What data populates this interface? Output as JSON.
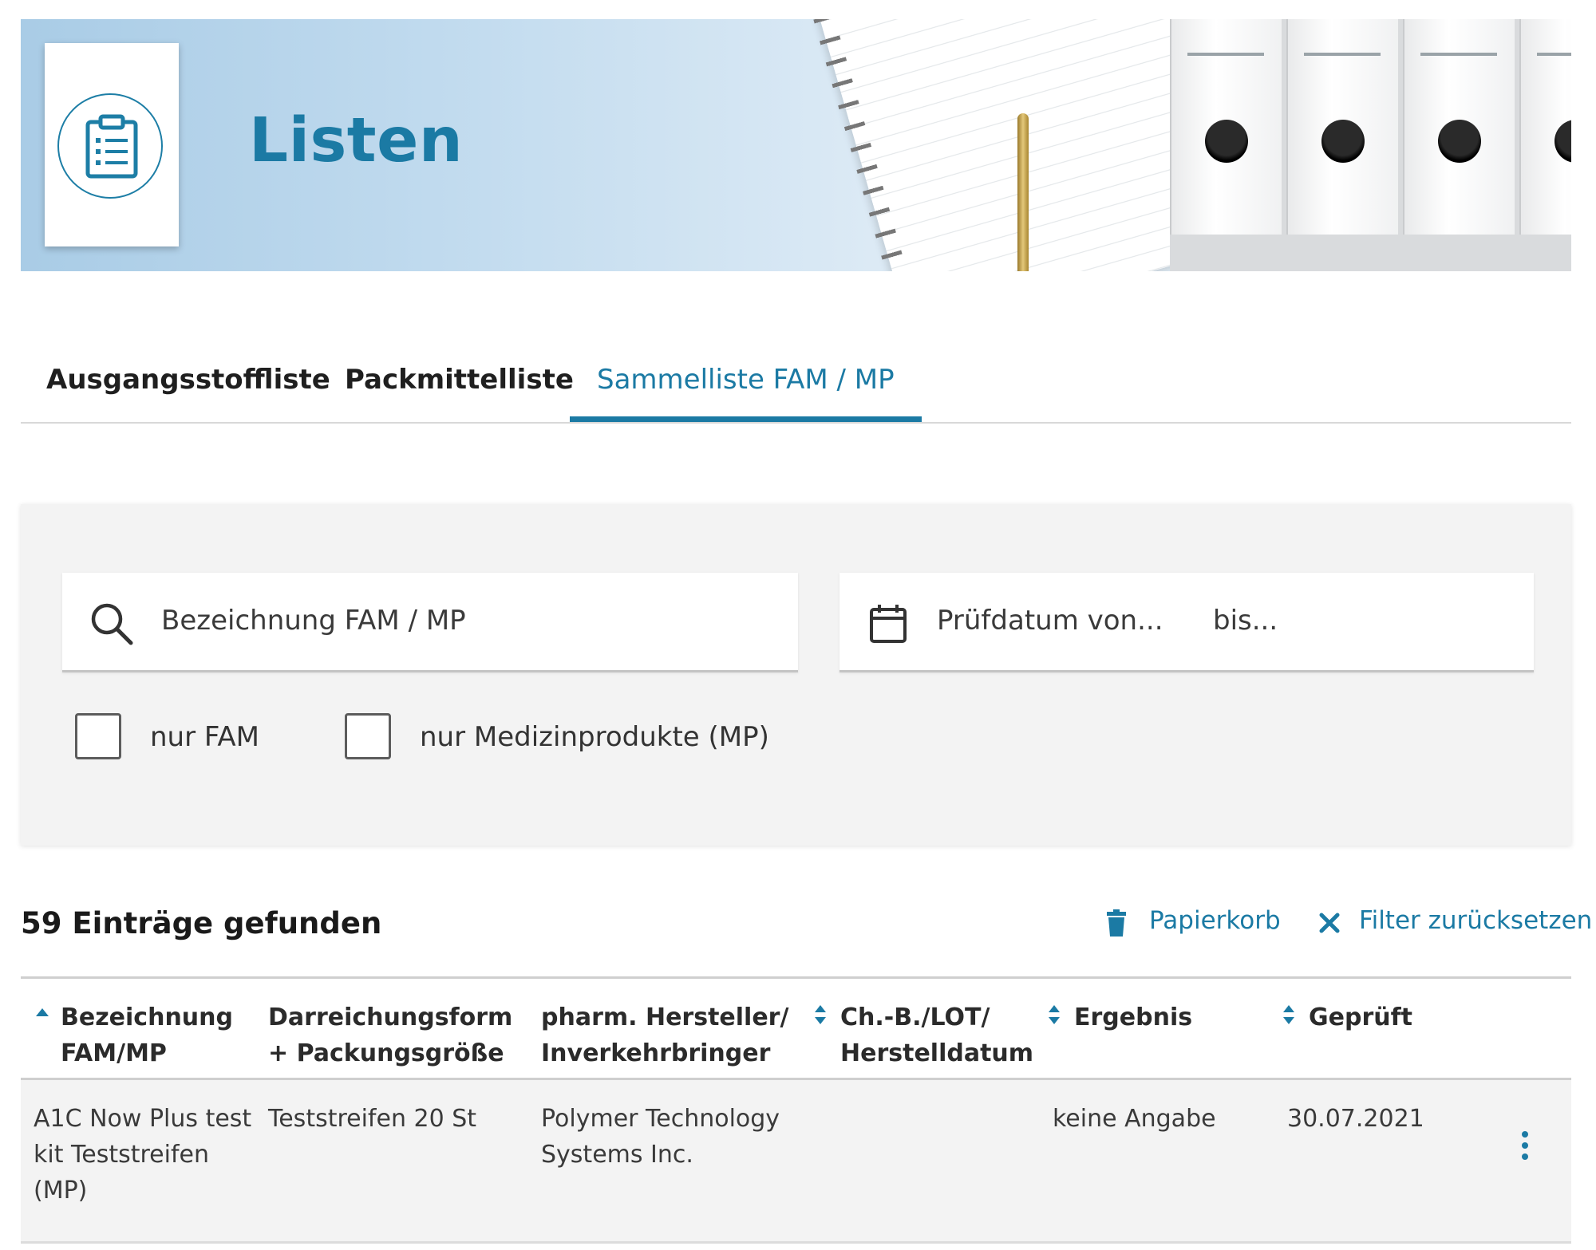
{
  "header": {
    "title": "Listen",
    "logo_icon": "clipboard-list-icon"
  },
  "tabs": [
    {
      "label": "Ausgangsstoffliste",
      "active": false
    },
    {
      "label": "Packmittelliste",
      "active": false
    },
    {
      "label": "Sammelliste FAM / MP",
      "active": true
    }
  ],
  "filters": {
    "search_placeholder": "Bezeichnung FAM / MP",
    "date_from_placeholder": "Prüfdatum von...",
    "date_to_placeholder": "bis...",
    "checkbox_fam": {
      "label": "nur FAM",
      "checked": false
    },
    "checkbox_mp": {
      "label": "nur Medizinprodukte (MP)",
      "checked": false
    }
  },
  "results": {
    "count_text": "59 Einträge gefunden",
    "trash_label": "Papierkorb",
    "reset_label": "Filter zurücksetzen"
  },
  "table": {
    "columns": [
      {
        "line1": "Bezeichnung",
        "line2": "FAM/MP",
        "sort": "asc"
      },
      {
        "line1": "Darreichungsform",
        "line2": "+ Packungsgröße",
        "sort": "none"
      },
      {
        "line1": "pharm. Hersteller/",
        "line2": "Inverkehrbringer",
        "sort": "none"
      },
      {
        "line1": "Ch.-B./LOT/",
        "line2": "Herstelldatum",
        "sort": "both"
      },
      {
        "line1": "Ergebnis",
        "line2": "",
        "sort": "both"
      },
      {
        "line1": "Geprüft",
        "line2": "",
        "sort": "both"
      }
    ],
    "rows": [
      {
        "name": [
          "A1C Now Plus test",
          "kit Teststreifen",
          "(MP)"
        ],
        "form": "Teststreifen 20 St",
        "manufacturer": [
          "Polymer Technology",
          "Systems Inc."
        ],
        "lot": "",
        "result": "keine Angabe",
        "checked": "30.07.2021"
      }
    ]
  },
  "colors": {
    "accent": "#1b7aa4",
    "panel": "#f3f3f3"
  }
}
